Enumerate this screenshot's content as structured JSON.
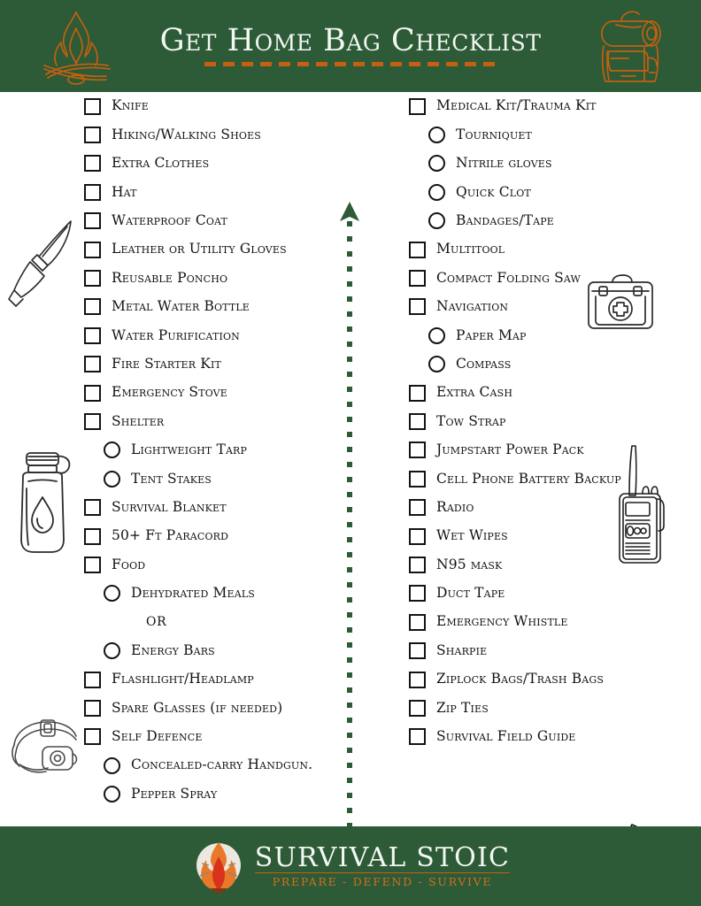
{
  "header": {
    "title": "Get Home Bag Checklist",
    "background_color": "#2d5a37",
    "title_color": "#f2f7f1",
    "accent_color": "#c4600f",
    "left_icon": "campfire-icon",
    "right_icon": "backpack-icon"
  },
  "divider": {
    "icon": "double-arrow-dotted-divider",
    "color": "#2d5a37"
  },
  "illustrations": [
    {
      "name": "knife-icon",
      "column": "left"
    },
    {
      "name": "water-bottle-icon",
      "column": "left"
    },
    {
      "name": "headlamp-icon",
      "column": "left"
    },
    {
      "name": "first-aid-kit-icon",
      "column": "right"
    },
    {
      "name": "handheld-radio-icon",
      "column": "right"
    },
    {
      "name": "open-book-icon",
      "column": "right"
    }
  ],
  "left_column": [
    {
      "label": "Knife",
      "mark": "box",
      "level": 0
    },
    {
      "label": "Hiking/Walking Shoes",
      "mark": "box",
      "level": 0
    },
    {
      "label": "Extra Clothes",
      "mark": "box",
      "level": 0
    },
    {
      "label": "Hat",
      "mark": "box",
      "level": 0
    },
    {
      "label": "Waterproof Coat",
      "mark": "box",
      "level": 0
    },
    {
      "label": "Leather or Utility Gloves",
      "mark": "box",
      "level": 0
    },
    {
      "label": "Reusable Poncho",
      "mark": "box",
      "level": 0
    },
    {
      "label": "Metal Water Bottle",
      "mark": "box",
      "level": 0
    },
    {
      "label": "Water Purification",
      "mark": "box",
      "level": 0
    },
    {
      "label": "Fire Starter Kit",
      "mark": "box",
      "level": 0
    },
    {
      "label": "Emergency Stove",
      "mark": "box",
      "level": 0
    },
    {
      "label": "Shelter",
      "mark": "box",
      "level": 0
    },
    {
      "label": "Lightweight Tarp",
      "mark": "circle",
      "level": 1
    },
    {
      "label": "Tent Stakes",
      "mark": "circle",
      "level": 1
    },
    {
      "label": "Survival Blanket",
      "mark": "box",
      "level": 0
    },
    {
      "label": "50+ Ft Paracord",
      "mark": "box",
      "level": 0
    },
    {
      "label": "Food",
      "mark": "box",
      "level": 0
    },
    {
      "label": "Dehydrated Meals",
      "mark": "circle",
      "level": 1
    },
    {
      "label": "OR",
      "mark": "none",
      "level": 1
    },
    {
      "label": "Energy Bars",
      "mark": "circle",
      "level": 1
    },
    {
      "label": "Flashlight/Headlamp",
      "mark": "box",
      "level": 0
    },
    {
      "label": "Spare Glasses (if needed)",
      "mark": "box",
      "level": 0
    },
    {
      "label": "Self Defence",
      "mark": "box",
      "level": 0
    },
    {
      "label": "Concealed-carry Handgun.",
      "mark": "circle",
      "level": 1
    },
    {
      "label": "Pepper Spray",
      "mark": "circle",
      "level": 1
    }
  ],
  "right_column": [
    {
      "label": "Medical Kit/Trauma Kit",
      "mark": "box",
      "level": 0
    },
    {
      "label": "Tourniquet",
      "mark": "circle",
      "level": 1
    },
    {
      "label": "Nitrile gloves",
      "mark": "circle",
      "level": 1
    },
    {
      "label": "Quick Clot",
      "mark": "circle",
      "level": 1
    },
    {
      "label": "Bandages/Tape",
      "mark": "circle",
      "level": 1
    },
    {
      "label": "Multitool",
      "mark": "box",
      "level": 0
    },
    {
      "label": "Compact Folding Saw",
      "mark": "box",
      "level": 0
    },
    {
      "label": "Navigation",
      "mark": "box",
      "level": 0
    },
    {
      "label": "Paper Map",
      "mark": "circle",
      "level": 1
    },
    {
      "label": "Compass",
      "mark": "circle",
      "level": 1
    },
    {
      "label": "Extra Cash",
      "mark": "box",
      "level": 0
    },
    {
      "label": "Tow Strap",
      "mark": "box",
      "level": 0
    },
    {
      "label": "Jumpstart Power Pack",
      "mark": "box",
      "level": 0
    },
    {
      "label": "Cell Phone Battery Backup",
      "mark": "box",
      "level": 0
    },
    {
      "label": "Radio",
      "mark": "box",
      "level": 0
    },
    {
      "label": "Wet Wipes",
      "mark": "box",
      "level": 0
    },
    {
      "label": "N95 mask",
      "mark": "box",
      "level": 0
    },
    {
      "label": "Duct Tape",
      "mark": "box",
      "level": 0
    },
    {
      "label": "Emergency Whistle",
      "mark": "box",
      "level": 0
    },
    {
      "label": "Sharpie",
      "mark": "box",
      "level": 0
    },
    {
      "label": "Ziplock Bags/Trash Bags",
      "mark": "box",
      "level": 0
    },
    {
      "label": "Zip Ties",
      "mark": "box",
      "level": 0
    },
    {
      "label": "Survival Field Guide",
      "mark": "box",
      "level": 0
    }
  ],
  "footer": {
    "brand": "SURVIVAL STOIC",
    "tagline": "PREPARE - DEFEND - SURVIVE",
    "background_color": "#2d5a37",
    "brand_color": "#f4f8f3",
    "tagline_color": "#d2711d",
    "logo_icon": "stoic-figure-flame-logo"
  }
}
